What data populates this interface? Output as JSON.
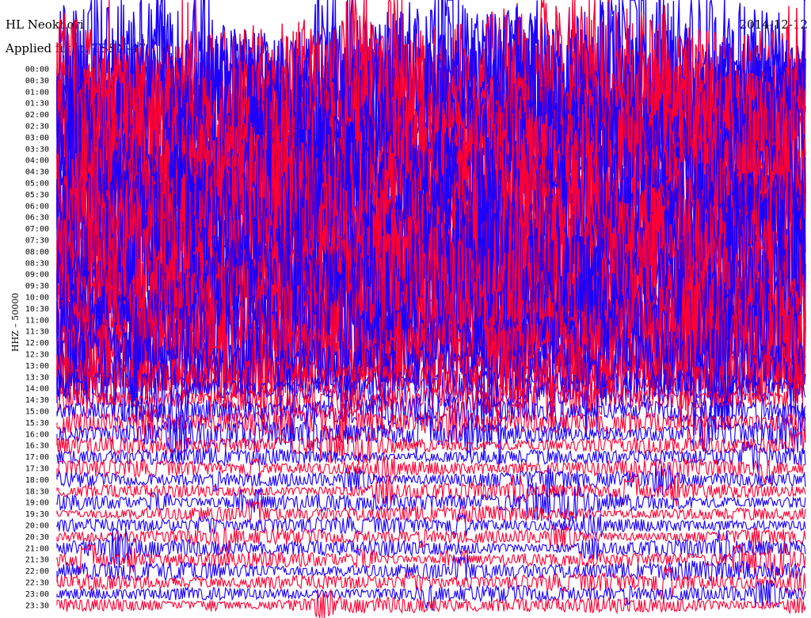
{
  "header": {
    "station": "HL Neokhori",
    "filter": "Applied filter: TSSN-47",
    "date": "2014-12-12"
  },
  "channel_label": "HHZ – 50000",
  "colors": {
    "trace_a": "#ff0033",
    "trace_b": "#1a00ff",
    "background": "#ffffff"
  },
  "chart_data": {
    "type": "helicorder",
    "title": "HL Neokhori",
    "subtitle": "Applied filter: TSSN-47",
    "ylabel": "HHZ – 50000",
    "rows": [
      {
        "time": "00:00",
        "amplitude": 1.0,
        "color": "trace_b"
      },
      {
        "time": "00:30",
        "amplitude": 1.0,
        "color": "trace_a"
      },
      {
        "time": "01:00",
        "amplitude": 1.0,
        "color": "trace_b"
      },
      {
        "time": "01:30",
        "amplitude": 1.0,
        "color": "trace_a"
      },
      {
        "time": "02:00",
        "amplitude": 1.0,
        "color": "trace_b"
      },
      {
        "time": "02:30",
        "amplitude": 1.0,
        "color": "trace_a"
      },
      {
        "time": "03:00",
        "amplitude": 1.0,
        "color": "trace_b"
      },
      {
        "time": "03:30",
        "amplitude": 1.0,
        "color": "trace_a"
      },
      {
        "time": "04:00",
        "amplitude": 1.0,
        "color": "trace_b"
      },
      {
        "time": "04:30",
        "amplitude": 1.0,
        "color": "trace_a"
      },
      {
        "time": "05:00",
        "amplitude": 1.0,
        "color": "trace_b"
      },
      {
        "time": "05:30",
        "amplitude": 1.0,
        "color": "trace_a"
      },
      {
        "time": "06:00",
        "amplitude": 1.0,
        "color": "trace_b"
      },
      {
        "time": "06:30",
        "amplitude": 1.0,
        "color": "trace_a"
      },
      {
        "time": "07:00",
        "amplitude": 1.0,
        "color": "trace_b"
      },
      {
        "time": "07:30",
        "amplitude": 1.0,
        "color": "trace_a"
      },
      {
        "time": "08:00",
        "amplitude": 1.0,
        "color": "trace_b"
      },
      {
        "time": "08:30",
        "amplitude": 1.0,
        "color": "trace_a"
      },
      {
        "time": "09:00",
        "amplitude": 1.0,
        "color": "trace_b"
      },
      {
        "time": "09:30",
        "amplitude": 1.0,
        "color": "trace_a"
      },
      {
        "time": "10:00",
        "amplitude": 0.95,
        "color": "trace_b"
      },
      {
        "time": "10:30",
        "amplitude": 0.9,
        "color": "trace_a"
      },
      {
        "time": "11:00",
        "amplitude": 0.85,
        "color": "trace_b"
      },
      {
        "time": "11:30",
        "amplitude": 0.8,
        "color": "trace_a"
      },
      {
        "time": "12:00",
        "amplitude": 0.7,
        "color": "trace_b"
      },
      {
        "time": "12:30",
        "amplitude": 0.6,
        "color": "trace_a"
      },
      {
        "time": "13:00",
        "amplitude": 0.45,
        "color": "trace_b"
      },
      {
        "time": "13:30",
        "amplitude": 0.32,
        "color": "trace_a"
      },
      {
        "time": "14:00",
        "amplitude": 0.24,
        "color": "trace_b"
      },
      {
        "time": "14:30",
        "amplitude": 0.2,
        "color": "trace_a"
      },
      {
        "time": "15:00",
        "amplitude": 0.18,
        "color": "trace_b"
      },
      {
        "time": "15:30",
        "amplitude": 0.18,
        "color": "trace_a"
      },
      {
        "time": "16:00",
        "amplitude": 0.16,
        "color": "trace_b"
      },
      {
        "time": "16:30",
        "amplitude": 0.12,
        "color": "trace_a"
      },
      {
        "time": "17:00",
        "amplitude": 0.11,
        "color": "trace_b"
      },
      {
        "time": "17:30",
        "amplitude": 0.11,
        "color": "trace_a"
      },
      {
        "time": "18:00",
        "amplitude": 0.11,
        "color": "trace_b"
      },
      {
        "time": "18:30",
        "amplitude": 0.1,
        "color": "trace_a"
      },
      {
        "time": "19:00",
        "amplitude": 0.12,
        "color": "trace_b"
      },
      {
        "time": "19:30",
        "amplitude": 0.1,
        "color": "trace_a"
      },
      {
        "time": "20:00",
        "amplitude": 0.1,
        "color": "trace_b"
      },
      {
        "time": "20:30",
        "amplitude": 0.1,
        "color": "trace_a"
      },
      {
        "time": "21:00",
        "amplitude": 0.11,
        "color": "trace_b"
      },
      {
        "time": "21:30",
        "amplitude": 0.1,
        "color": "trace_a"
      },
      {
        "time": "22:00",
        "amplitude": 0.12,
        "color": "trace_b"
      },
      {
        "time": "22:30",
        "amplitude": 0.11,
        "color": "trace_a"
      },
      {
        "time": "23:00",
        "amplitude": 0.1,
        "color": "trace_b"
      },
      {
        "time": "23:30",
        "amplitude": 0.1,
        "color": "trace_a"
      }
    ],
    "grid": false
  }
}
